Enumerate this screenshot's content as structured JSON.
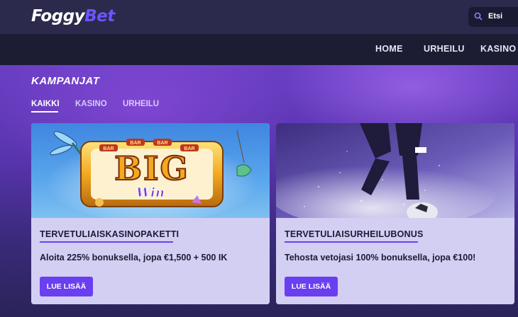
{
  "header": {
    "logo_part1": "Foggy",
    "logo_part2": "Bet",
    "search_placeholder": "Etsi"
  },
  "nav": {
    "items": [
      "HOME",
      "URHEILU",
      "KASINO"
    ]
  },
  "promotions": {
    "title": "KAMPANJAT",
    "tabs": [
      "KAIKKI",
      "KASINO",
      "URHEILU"
    ],
    "active_tab": "KAIKKI",
    "cards": [
      {
        "title": "TERVETULIAISKASINOPAKETTI",
        "description": "Aloita 225% bonuksella, jopa €1,500 + 500 IK",
        "button": "LUE LISÄÄ",
        "image_big": "BIG",
        "image_win": "Win",
        "reel_labels": [
          "BAR",
          "BAR",
          "BAR",
          "BAR"
        ]
      },
      {
        "title": "TERVETULIAISURHEILUBONUS",
        "description": "Tehosta vetojasi 100% bonuksella, jopa €100!",
        "button": "LUE LISÄÄ"
      }
    ]
  },
  "colors": {
    "accent": "#6a3ff0",
    "header_bg": "#2b2a4c",
    "nav_bg": "#1c1d33",
    "card_body": "#d3cff3"
  }
}
